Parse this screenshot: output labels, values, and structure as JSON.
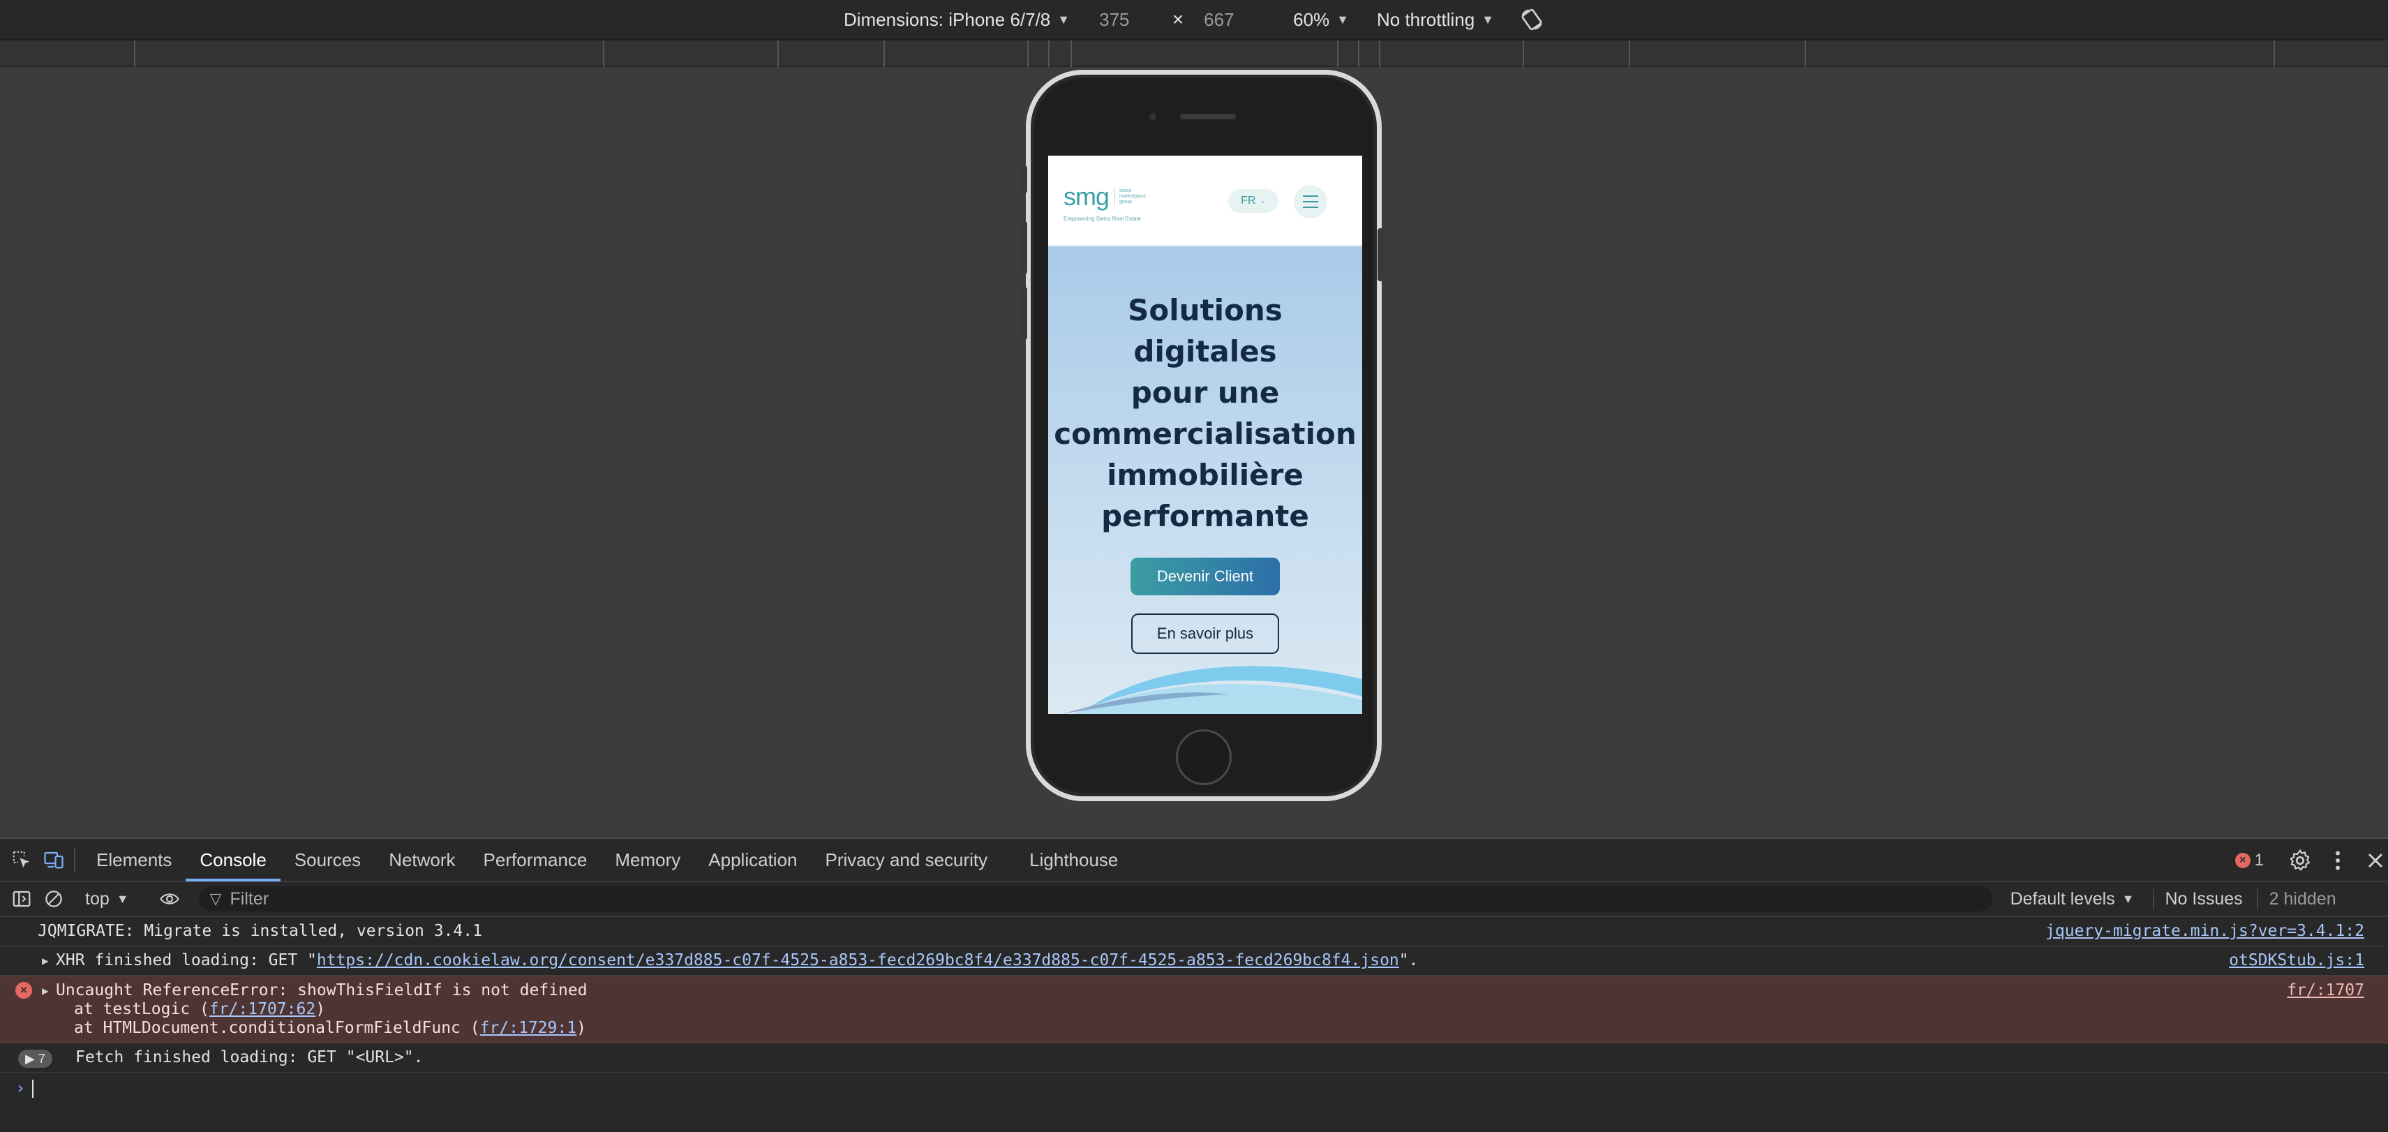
{
  "device_toolbar": {
    "dimensions_label": "Dimensions: iPhone 6/7/8",
    "width_value": "375",
    "times": "×",
    "height_value": "667",
    "zoom": "60%",
    "throttling": "No throttling",
    "rotate_icon": "rotate-icon"
  },
  "site": {
    "logo_text": "smg",
    "logo_sub_lines": [
      "swiss",
      "marketplace",
      "group"
    ],
    "logo_tagline": "Empowering Swiss Real Estate",
    "lang_label": "FR",
    "hero_title_lines": [
      "Solutions",
      "digitales",
      "pour une",
      "commercialisation",
      "immobilière",
      "performante"
    ],
    "primary_cta": "Devenir Client",
    "secondary_cta": "En savoir plus",
    "colors": {
      "brand_teal": "#3ba1a6",
      "hero_text": "#142a44"
    }
  },
  "devtools": {
    "tabs": [
      "Elements",
      "Console",
      "Sources",
      "Network",
      "Performance",
      "Memory",
      "Application",
      "Privacy and security",
      "Lighthouse"
    ],
    "active_tab": "Console",
    "error_count": "1",
    "console_toolbar": {
      "context": "top",
      "filter_placeholder": "Filter",
      "levels": "Default levels",
      "issues": "No Issues",
      "hidden": "2 hidden"
    },
    "messages": [
      {
        "text": "JQMIGRATE: Migrate is installed, version 3.4.1",
        "source": "jquery-migrate.min.js?ver=3.4.1:2"
      },
      {
        "prefix": "XHR finished loading: GET \"",
        "url": "https://cdn.cookielaw.org/consent/e337d885-c07f-4525-a853-fecd269bc8f4/e337d885-c07f-4525-a853-fecd269bc8f4.json",
        "suffix": "\".",
        "source": "otSDKStub.js:1"
      },
      {
        "text": "Uncaught ReferenceError: showThisFieldIf is not defined",
        "stack1_prefix": "at testLogic (",
        "stack1_link": "fr/:1707:62",
        "stack1_suffix": ")",
        "stack2_prefix": "at HTMLDocument.conditionalFormFieldFunc (",
        "stack2_link": "fr/:1729:1",
        "stack2_suffix": ")",
        "source": "fr/:1707"
      },
      {
        "repeat": "7",
        "text": "Fetch finished loading: GET \"<URL>\"."
      }
    ],
    "prompt_symbol": "›"
  }
}
